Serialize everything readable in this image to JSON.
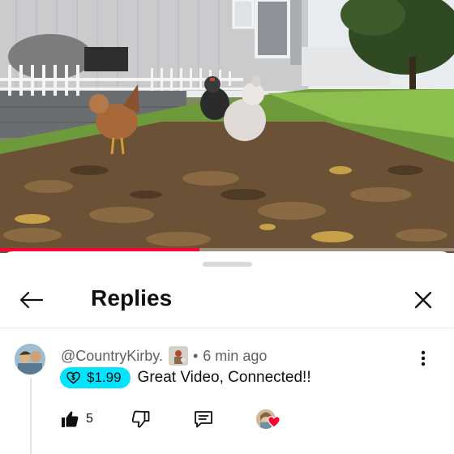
{
  "video": {
    "progress_fraction": 0.44,
    "progress_color": "#ff0033"
  },
  "sheet": {
    "title": "Replies",
    "back_icon": "arrow-left-icon",
    "close_icon": "close-icon"
  },
  "comment": {
    "handle": "@CountryKirby.",
    "separator": "•",
    "time": "6 min ago",
    "super_thanks": {
      "amount": "$1.99",
      "color": "#00e5ff",
      "icon": "dollar-heart-icon"
    },
    "text": "Great Video, Connected!!",
    "likes": "5",
    "icons": {
      "like": "thumb-up-icon",
      "dislike": "thumb-down-icon",
      "reply": "reply-icon",
      "more": "more-vert-icon",
      "creator_heart": "creator-heart-icon"
    },
    "heart_color": "#ff0033"
  }
}
